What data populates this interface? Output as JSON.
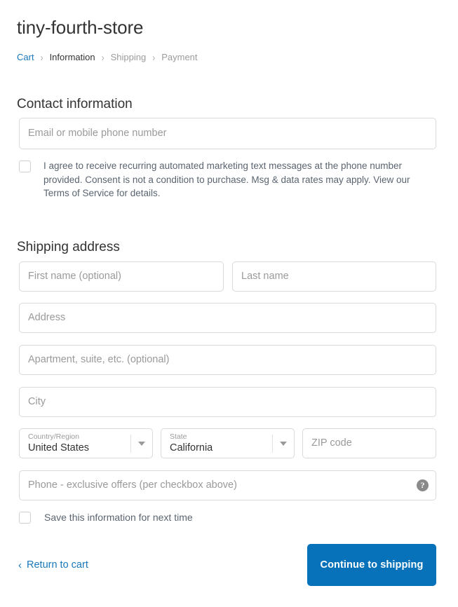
{
  "store": {
    "name": "tiny-fourth-store"
  },
  "breadcrumb": {
    "separator": "›",
    "items": [
      {
        "label": "Cart",
        "state": "link"
      },
      {
        "label": "Information",
        "state": "current"
      },
      {
        "label": "Shipping",
        "state": "future"
      },
      {
        "label": "Payment",
        "state": "future"
      }
    ]
  },
  "contact": {
    "heading": "Contact information",
    "email": {
      "placeholder": "Email or mobile phone number",
      "value": ""
    },
    "consent": {
      "checked": false,
      "label": "I agree to receive recurring automated marketing text messages at the phone number provided.  Consent is not a condition to purchase.  Msg & data rates may apply.  View our Terms of Service for details."
    }
  },
  "shipping": {
    "heading": "Shipping address",
    "first_name": {
      "placeholder": "First name (optional)",
      "value": ""
    },
    "last_name": {
      "placeholder": "Last name",
      "value": ""
    },
    "address": {
      "placeholder": "Address",
      "value": ""
    },
    "apartment": {
      "placeholder": "Apartment, suite, etc. (optional)",
      "value": ""
    },
    "city": {
      "placeholder": "City",
      "value": ""
    },
    "country": {
      "label": "Country/Region",
      "value": "United States"
    },
    "state": {
      "label": "State",
      "value": "California"
    },
    "zip": {
      "placeholder": "ZIP code",
      "value": ""
    },
    "phone": {
      "placeholder": "Phone - exclusive offers (per checkbox above)",
      "value": "",
      "help_icon": "question-mark-icon",
      "help_glyph": "?"
    },
    "save_info": {
      "checked": false,
      "label": "Save this information for next time"
    }
  },
  "footer": {
    "return_link": "Return to cart",
    "return_chevron": "‹",
    "continue_button": "Continue to shipping"
  },
  "colors": {
    "link": "#1878b9",
    "button": "#0772ba",
    "text": "#333333",
    "muted": "#9a9a9a",
    "border": "#d9d9d9"
  }
}
